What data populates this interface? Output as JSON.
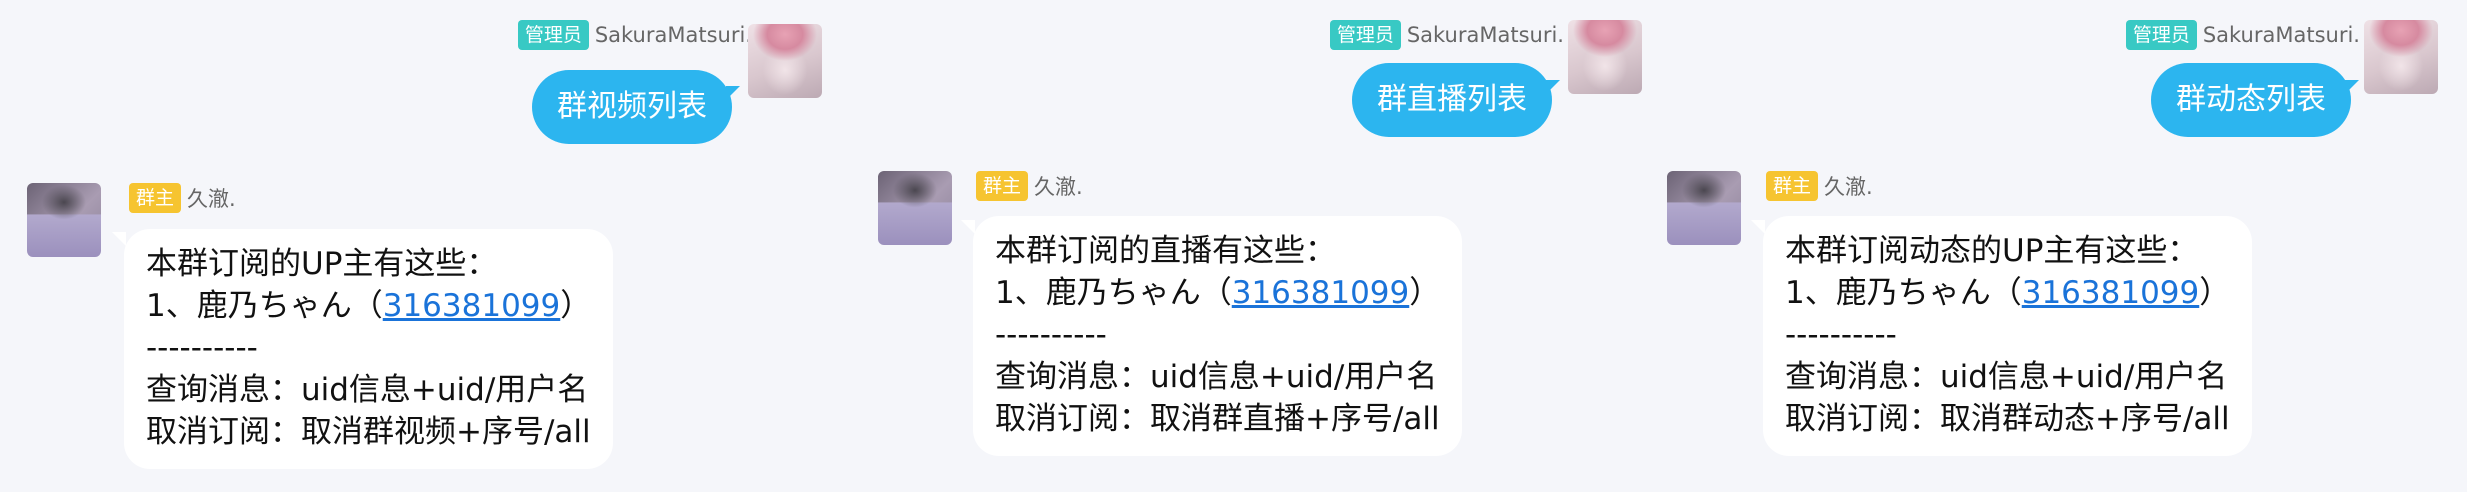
{
  "chats": [
    {
      "request": {
        "badge": "管理员",
        "sender": "SakuraMatsuri.",
        "text": "群视频列表"
      },
      "reply": {
        "badge": "群主",
        "sender": "久澈.",
        "header": "本群订阅的UP主有这些：",
        "item_prefix": "1、鹿乃ちゃん（",
        "item_uid": "316381099",
        "item_suffix": "）",
        "divider": "----------",
        "query_hint": "查询消息：uid信息+uid/用户名",
        "cancel_hint": "取消订阅：取消群视频+序号/all"
      }
    },
    {
      "request": {
        "badge": "管理员",
        "sender": "SakuraMatsuri.",
        "text": "群直播列表"
      },
      "reply": {
        "badge": "群主",
        "sender": "久澈.",
        "header": "本群订阅的直播有这些：",
        "item_prefix": "1、鹿乃ちゃん（",
        "item_uid": "316381099",
        "item_suffix": "）",
        "divider": "----------",
        "query_hint": "查询消息：uid信息+uid/用户名",
        "cancel_hint": "取消订阅：取消群直播+序号/all"
      }
    },
    {
      "request": {
        "badge": "管理员",
        "sender": "SakuraMatsuri.",
        "text": "群动态列表"
      },
      "reply": {
        "badge": "群主",
        "sender": "久澈.",
        "header": "本群订阅动态的UP主有这些：",
        "item_prefix": "1、鹿乃ちゃん（",
        "item_uid": "316381099",
        "item_suffix": "）",
        "divider": "----------",
        "query_hint": "查询消息：uid信息+uid/用户名",
        "cancel_hint": "取消订阅：取消群动态+序号/all"
      }
    }
  ],
  "colors": {
    "background": "#f5f6fa",
    "outgoing_bubble": "#2cb5ef",
    "admin_badge": "#38c9c4",
    "owner_badge": "#f6c430",
    "link": "#1a73d9"
  }
}
